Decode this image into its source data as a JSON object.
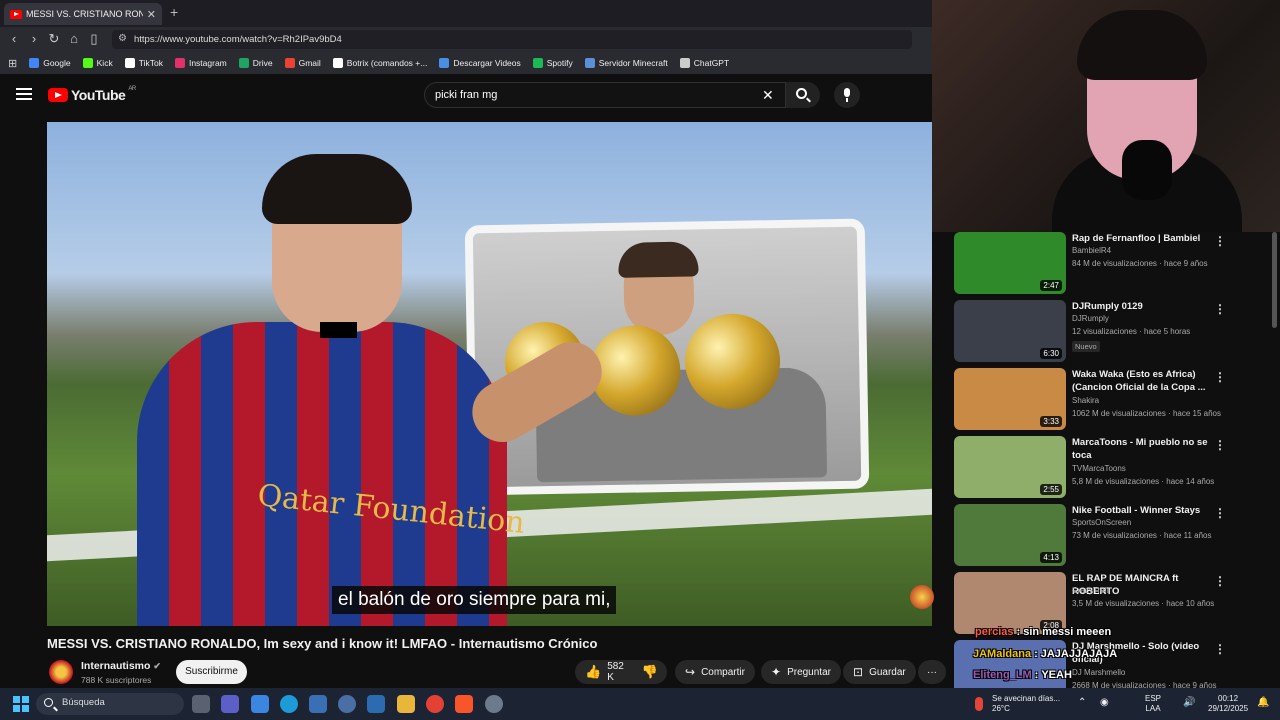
{
  "browser": {
    "tab_title": "MESSI VS. CRISTIANO RONAL",
    "tab_close": "✕",
    "new_tab": "+",
    "url": "https://www.youtube.com/watch?v=Rh2IPav9bD4",
    "bookmarks": [
      {
        "label": "Google",
        "color": "#4285f4"
      },
      {
        "label": "Kick",
        "color": "#53fc18"
      },
      {
        "label": "TikTok",
        "color": "#ffffff"
      },
      {
        "label": "Instagram",
        "color": "#e1306c"
      },
      {
        "label": "Drive",
        "color": "#1fa463"
      },
      {
        "label": "Gmail",
        "color": "#ea4335"
      },
      {
        "label": "Botrix (comandos +...",
        "color": "#ffffff"
      },
      {
        "label": "Descargar Videos",
        "color": "#4a90e2"
      },
      {
        "label": "Spotify",
        "color": "#1db954"
      },
      {
        "label": "Servidor Minecraft",
        "color": "#5b8fd6"
      },
      {
        "label": "ChatGPT",
        "color": "#cccccc"
      }
    ]
  },
  "youtube": {
    "logo_text": "YouTube",
    "logo_region": "AR",
    "search_value": "picki fran mg",
    "clear_icon": "✕"
  },
  "video": {
    "subtitle": "el balón de oro siempre para mi,",
    "jersey_text": "Qatar Foundation",
    "title": "MESSI VS. CRISTIANO RONALDO, Im sexy and i know it! LMFAO - Internautismo Crónico",
    "channel": "Internautismo",
    "subscribers": "788 K suscriptores",
    "subscribe_label": "Suscribirme",
    "likes": "582 K",
    "share_label": "Compartir",
    "ask_label": "Preguntar",
    "save_label": "Guardar",
    "more_label": "···"
  },
  "recommendations": [
    {
      "title": "Rap de Fernanfloo | Bambiel",
      "channel": "BambielR4",
      "meta": "84 M de visualizaciones · hace 9 años",
      "duration": "2:47",
      "thumb": "#2f8a2a"
    },
    {
      "title": "DJRumply 0129",
      "channel": "DJRumply",
      "meta": "12 visualizaciones · hace 5 horas",
      "badge": "Nuevo",
      "duration": "6:30",
      "thumb": "#3a3f4a"
    },
    {
      "title": "Waka Waka (Esto es Africa) (Cancion Oficial de la Copa ...",
      "channel": "Shakira",
      "meta": "1062 M de visualizaciones · hace 15 años",
      "duration": "3:33",
      "thumb": "#c98a45"
    },
    {
      "title": "MarcaToons - Mi pueblo no se toca",
      "channel": "TVMarcaToons",
      "meta": "5,8 M de visualizaciones · hace 14 años",
      "duration": "2:55",
      "thumb": "#8fae6a"
    },
    {
      "title": "Nike Football  - Winner Stays",
      "channel": "SportsOnScreen",
      "meta": "73 M de visualizaciones · hace 11 años",
      "duration": "4:13",
      "thumb": "#4f7a3b"
    },
    {
      "title": "EL RAP DE MAINCRA ft ROBERTO",
      "channel": "CrazyTroll",
      "meta": "3,5 M de visualizaciones · hace 10 años",
      "duration": "2:08",
      "thumb": "#b08870"
    },
    {
      "title": "DJ Marshmello - Solo (video oficial)",
      "channel": "DJ Marshmello",
      "meta": "2668 M de visualizaciones · hace 9 años",
      "duration": "",
      "thumb": "#5a6fb0"
    }
  ],
  "chat": [
    {
      "user": "percias",
      "message": "sin messi meeen",
      "color": "#ff5a3c"
    },
    {
      "user": "JAMaldana",
      "message": "JAJAJJAJAJA",
      "color": "#f1c40f"
    },
    {
      "user": "Eliteng_LM",
      "message": "YEAH",
      "color": "#9b59b6"
    }
  ],
  "taskbar": {
    "search_placeholder": "Búsqueda",
    "weather_text": "Se avecinan días...",
    "temperature": "26°C",
    "lang": "ESP",
    "region": "LAA",
    "time": "00:12",
    "date": "29/12/2025"
  }
}
